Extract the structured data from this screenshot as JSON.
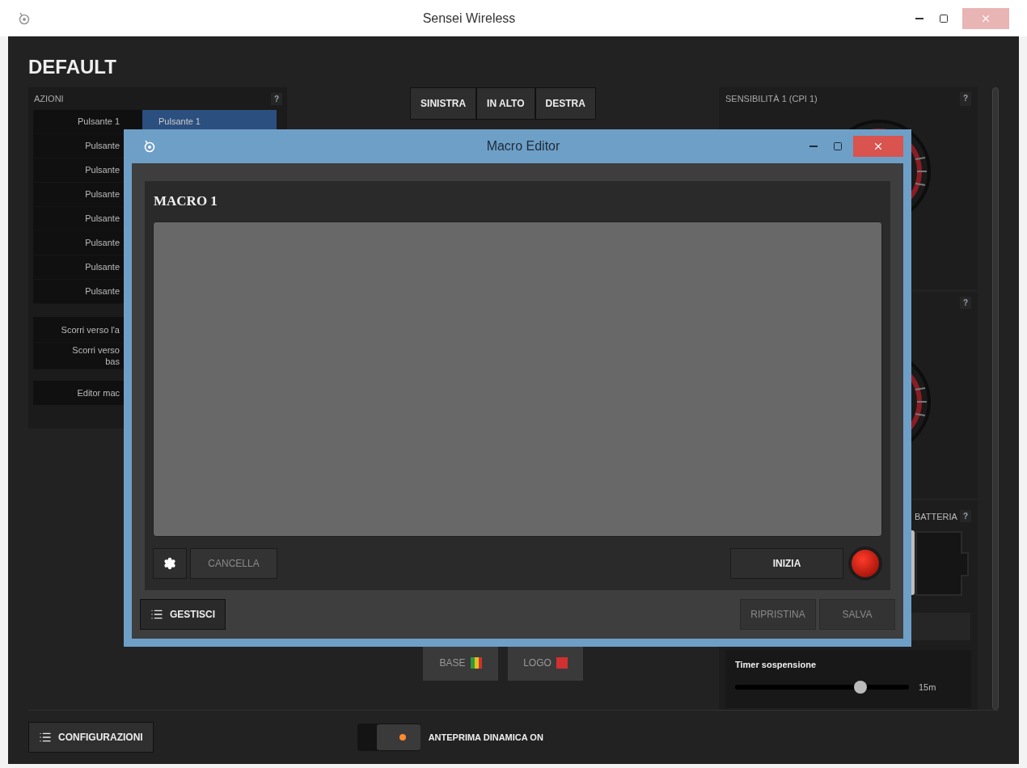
{
  "window": {
    "title": "Sensei Wireless"
  },
  "profile": {
    "name": "DEFAULT"
  },
  "actions_panel": {
    "title": "AZIONI",
    "help": "?",
    "assigned": {
      "text": "Pulsante 1",
      "selected": true
    },
    "rows": [
      {
        "label": "Pulsante 1"
      },
      {
        "label": "Pulsante"
      },
      {
        "label": "Pulsante"
      },
      {
        "label": "Pulsante"
      },
      {
        "label": "Pulsante"
      },
      {
        "label": "Pulsante"
      },
      {
        "label": "Pulsante"
      },
      {
        "label": "Pulsante"
      }
    ],
    "scroll_rows": [
      {
        "label": "Scorri verso l'a"
      },
      {
        "label": "Scorri verso\nbas"
      }
    ],
    "macro_row": {
      "label": "Editor mac"
    }
  },
  "view_tabs": [
    {
      "label": "SINISTRA"
    },
    {
      "label": "IN ALTO"
    },
    {
      "label": "DESTRA"
    }
  ],
  "sensitivity_panel": {
    "title": "SENSIBILITÀ 1 (CPI 1)",
    "help": "?"
  },
  "second_panel": {
    "help": "?"
  },
  "battery_panel": {
    "title": "BATTERIA",
    "help": "?"
  },
  "sleep_timer": {
    "label": "Timer sospensione",
    "level": 0.72,
    "reading": "15m"
  },
  "lighting": [
    {
      "label": "BASE",
      "kind": "multicolor"
    },
    {
      "label": "LOGO",
      "kind": "solid"
    }
  ],
  "configurations_button": {
    "label": "CONFIGURAZIONI"
  },
  "live_preview": {
    "label": "ANTEPRIMA DINAMICA ON",
    "on": true
  },
  "macro_editor": {
    "title": "Macro Editor",
    "macro_name": "MACRO 1",
    "clear_button": {
      "label": "CANCELLA",
      "disabled": true
    },
    "record_button": {
      "label": "INIZIA"
    },
    "manage_button": {
      "label": "GESTISCI"
    },
    "footer_buttons": [
      {
        "label": "RIPRISTINA",
        "disabled": true
      },
      {
        "label": "SALVA",
        "disabled": true
      }
    ]
  }
}
